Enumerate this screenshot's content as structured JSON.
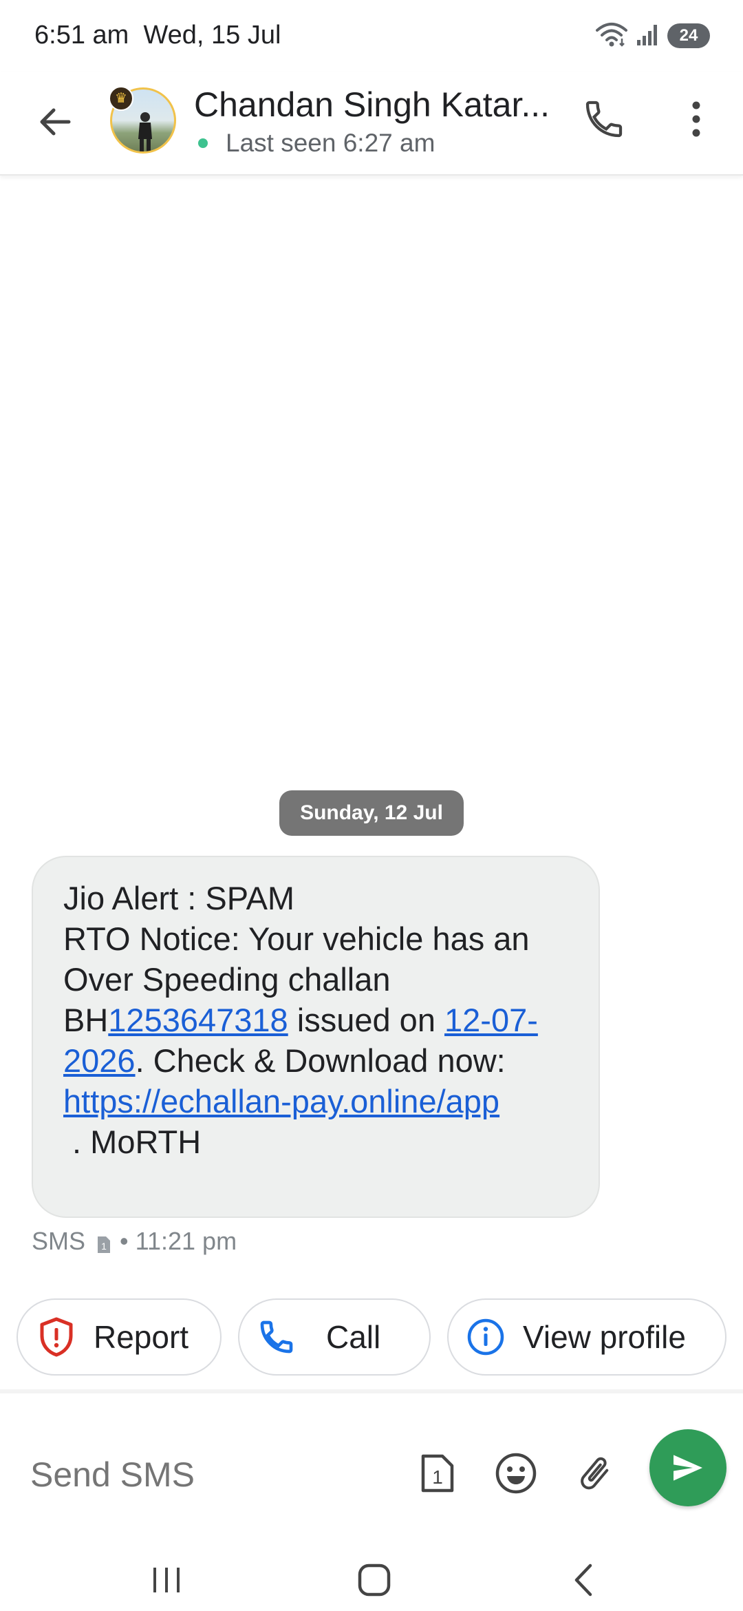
{
  "status_bar": {
    "time": "6:51 am",
    "date": "Wed, 15 Jul",
    "battery_level": "24",
    "icons": [
      "wifi-icon",
      "signal-icon",
      "battery-icon"
    ]
  },
  "header": {
    "contact_name": "Chandan Singh Katar...",
    "last_seen": "Last seen 6:27 am",
    "online_dot_color": "#3ec28f",
    "icons": [
      "back-arrow-icon",
      "crown-icon",
      "phone-icon",
      "more-vert-icon"
    ]
  },
  "conversation": {
    "date_divider": "Sunday, 12 Jul",
    "message": {
      "line1": "Jio Alert : SPAM",
      "line2_prefix": "RTO Notice: Your vehicle has an Over Speeding challan BH",
      "challan_number_link": "1253647318",
      "issued_on_text": " issued on ",
      "date_link": "12-07-2026",
      "check_text": ". Check & Download now:",
      "url_link": "https://echallan-pay.online/app",
      "trailer": " . MoRTH",
      "link_color": "#1a5fd6",
      "bubble_color": "#eef0ef"
    },
    "meta": {
      "type": "SMS",
      "sim": "1",
      "separator": "•",
      "time": "11:21 pm"
    }
  },
  "suggestions": {
    "report": "Report",
    "call": "Call",
    "view_profile": "View profile",
    "report_icon_color": "#d93025",
    "accent_blue": "#1a73e8"
  },
  "compose": {
    "placeholder": "Send SMS",
    "sim_label": "1",
    "send_button_color": "#2f9c58",
    "icons": [
      "sim-icon",
      "emoji-icon",
      "attach-icon",
      "send-icon"
    ]
  },
  "nav_bar": {
    "icons": [
      "recents-icon",
      "home-icon",
      "back-nav-icon"
    ]
  }
}
